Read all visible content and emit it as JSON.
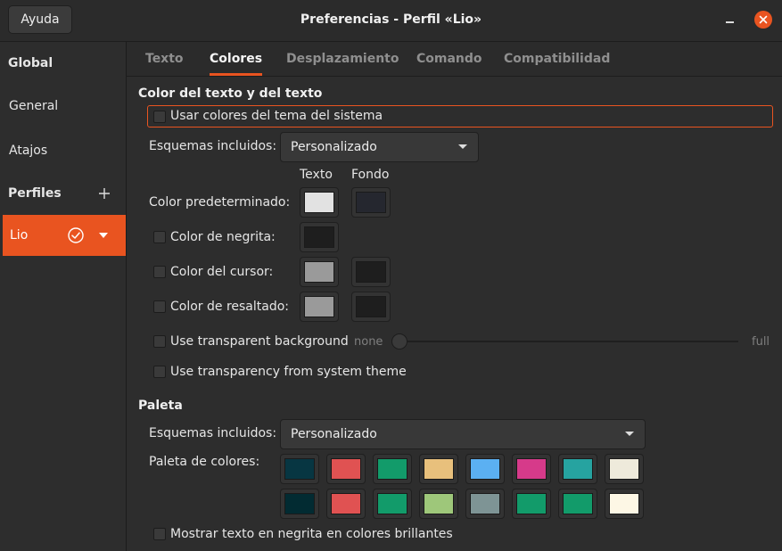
{
  "window": {
    "title": "Preferencias - Perfil «Lio»",
    "help_label": "Ayuda"
  },
  "sidebar": {
    "global_header": "Global",
    "items": [
      {
        "label": "General"
      },
      {
        "label": "Atajos"
      }
    ],
    "profiles_header": "Perfiles",
    "profile_item": {
      "label": "Lio",
      "is_default": true
    }
  },
  "tabs": [
    {
      "label": "Texto",
      "active": false
    },
    {
      "label": "Colores",
      "active": true
    },
    {
      "label": "Desplazamiento",
      "active": false
    },
    {
      "label": "Comando",
      "active": false
    },
    {
      "label": "Compatibilidad",
      "active": false
    }
  ],
  "text_colors": {
    "title": "Color del texto y del texto",
    "use_system_theme_label": "Usar colores del tema del sistema",
    "use_system_theme_checked": false,
    "schemes_label": "Esquemas incluidos:",
    "schemes_value": "Personalizado",
    "col_text": "Texto",
    "col_background": "Fondo",
    "default_label": "Color predeterminado:",
    "default_text_color": "#e2e2e2",
    "default_bg_color": "#25272f",
    "bold_label": "Color de negrita:",
    "bold_checked": false,
    "bold_color": "#1e1e1e",
    "cursor_label": "Color del cursor:",
    "cursor_checked": false,
    "cursor_text_color": "#9a9a9a",
    "cursor_bg_color": "#1e1e1e",
    "highlight_label": "Color de resaltado:",
    "highlight_checked": false,
    "highlight_text_color": "#9a9a9a",
    "highlight_bg_color": "#1e1e1e",
    "transparent_bg_label": "Use transparent background",
    "transparent_bg_checked": false,
    "slider_min_label": "none",
    "slider_max_label": "full",
    "slider_value": 0,
    "transparency_system_label": "Use transparency from system theme",
    "transparency_system_checked": false
  },
  "palette": {
    "title": "Paleta",
    "schemes_label": "Esquemas incluidos:",
    "schemes_value": "Personalizado",
    "colors_label": "Paleta de colores:",
    "row1": [
      "#073642",
      "#e05252",
      "#129b6a",
      "#e8c07c",
      "#5bb0f2",
      "#d63a8a",
      "#26a3a0",
      "#eeeadb"
    ],
    "row2": [
      "#022b32",
      "#e05252",
      "#129b6a",
      "#9ec77a",
      "#7e9495",
      "#129b6a",
      "#129b6a",
      "#fdf7e5"
    ],
    "bright_bold_label": "Mostrar texto en negrita en colores brillantes",
    "bright_bold_checked": false
  }
}
